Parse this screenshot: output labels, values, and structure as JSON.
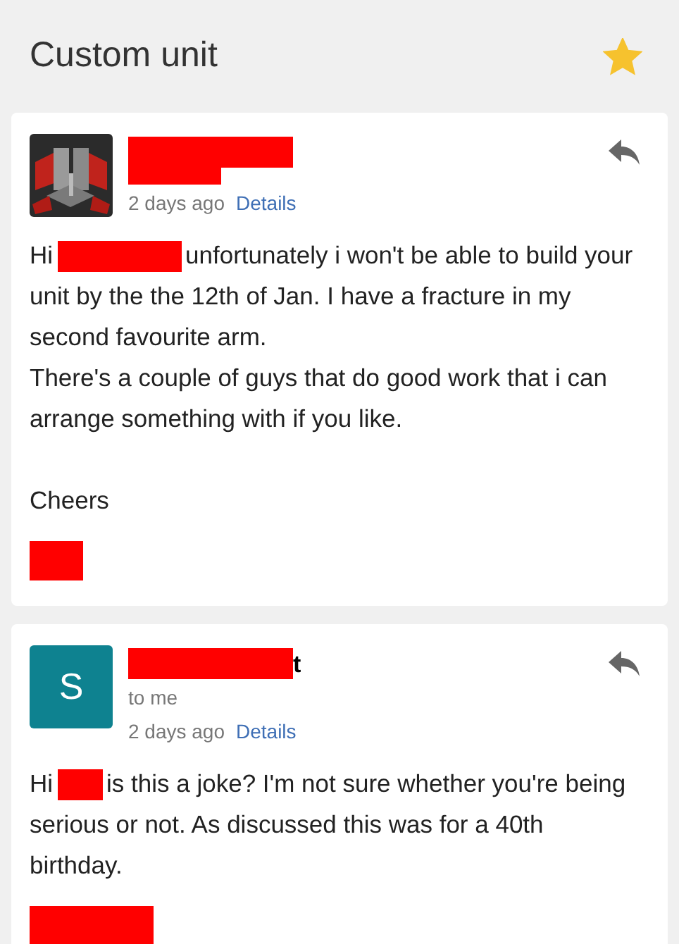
{
  "header": {
    "title": "Custom unit",
    "starred": true
  },
  "messages": [
    {
      "time": "2 days ago",
      "details": "Details",
      "paragraphs": [
        {
          "parts": [
            {
              "kind": "text",
              "text": "Hi"
            },
            {
              "kind": "redaction"
            },
            {
              "kind": "text",
              "text": "unfortunately i won't be able to build your unit by the the 12th of Jan. I have a fracture in my second favourite arm."
            }
          ]
        },
        {
          "parts": [
            {
              "kind": "text",
              "text": "There's a couple of guys that do good work that i can arrange something with if you like."
            }
          ]
        },
        {
          "parts": [
            {
              "kind": "text",
              "text": "Cheers"
            }
          ]
        }
      ],
      "signature_redacted": true
    },
    {
      "avatar": {
        "kind": "letter",
        "letter": "S"
      },
      "sender": "t",
      "recipient": "to me",
      "time": "2 days ago",
      "details": "Details",
      "paragraphs": [
        {
          "parts": [
            {
              "kind": "text",
              "text": "Hi"
            },
            {
              "kind": "redaction"
            },
            {
              "kind": "text",
              "text": "is this a joke? I'm not sure whether you're being serious or not. As discussed this was for a 40th birthday."
            }
          ]
        }
      ],
      "signature_redacted": true
    }
  ]
}
